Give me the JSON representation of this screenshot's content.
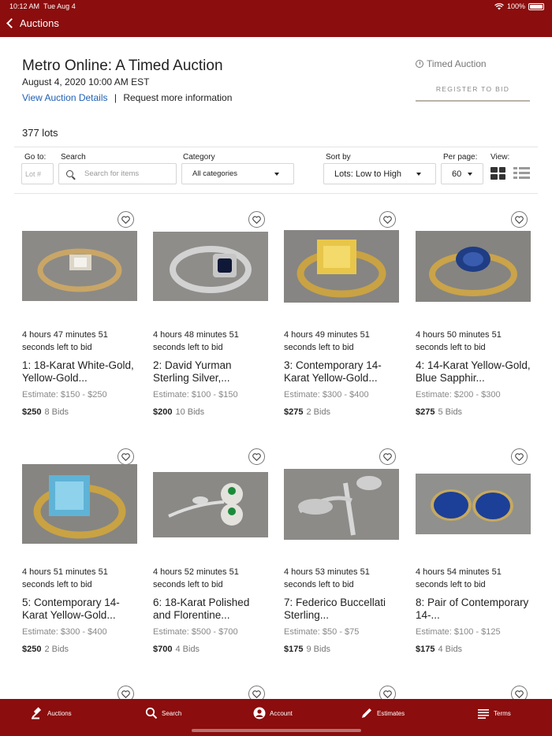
{
  "status": {
    "time": "10:12 AM",
    "date": "Tue Aug 4",
    "battery": "100%"
  },
  "nav": {
    "back_label": "Auctions"
  },
  "auction": {
    "title": "Metro Online: A Timed Auction",
    "date": "August 4, 2020 10:00 AM EST",
    "details_link": "View Auction Details",
    "separator": "|",
    "request_info": "Request more information",
    "type": "Timed Auction",
    "register_label": "REGISTER TO BID",
    "lot_count": "377 lots"
  },
  "filters": {
    "goto_label": "Go to:",
    "goto_placeholder": "Lot #",
    "search_label": "Search",
    "search_placeholder": "Search for items",
    "category_label": "Category",
    "category_value": "All categories",
    "sort_label": "Sort by",
    "sort_value": "Lots: Low to High",
    "perpage_label": "Per page:",
    "perpage_value": "60",
    "view_label": "View:"
  },
  "lots": [
    {
      "time_left": "4 hours 47 minutes 51 seconds left to bid",
      "name": "1: 18-Karat White-Gold, Yellow-Gold...",
      "estimate": "Estimate: $150 - $250",
      "price": "$250",
      "bids": "8 Bids",
      "image": "ring-white-gold"
    },
    {
      "time_left": "4 hours 48 minutes 51 seconds left to bid",
      "name": "2: David Yurman Sterling Silver,...",
      "estimate": "Estimate: $100 - $150",
      "price": "$200",
      "bids": "10 Bids",
      "image": "ring-yurman"
    },
    {
      "time_left": "4 hours 49 minutes 51 seconds left to bid",
      "name": "3: Contemporary 14-Karat Yellow-Gold...",
      "estimate": "Estimate: $300 - $400",
      "price": "$275",
      "bids": "2 Bids",
      "image": "ring-citrine"
    },
    {
      "time_left": "4 hours 50 minutes 51 seconds left to bid",
      "name": "4: 14-Karat Yellow-Gold, Blue Sapphir...",
      "estimate": "Estimate: $200 - $300",
      "price": "$275",
      "bids": "5 Bids",
      "image": "ring-sapphire"
    },
    {
      "time_left": "4 hours 51 minutes 51 seconds left to bid",
      "name": "5: Contemporary 14-Karat Yellow-Gold...",
      "estimate": "Estimate: $300 - $400",
      "price": "$250",
      "bids": "2 Bids",
      "image": "ring-blue-topaz"
    },
    {
      "time_left": "4 hours 52 minutes 51 seconds left to bid",
      "name": "6: 18-Karat Polished and Florentine...",
      "estimate": "Estimate: $500 - $700",
      "price": "$700",
      "bids": "4 Bids",
      "image": "brooch-flower"
    },
    {
      "time_left": "4 hours 53 minutes 51 seconds left to bid",
      "name": "7: Federico Buccellati Sterling...",
      "estimate": "Estimate: $50 - $75",
      "price": "$175",
      "bids": "9 Bids",
      "image": "silver-branch"
    },
    {
      "time_left": "4 hours 54 minutes 51 seconds left to bid",
      "name": "8: Pair of Contemporary 14-...",
      "estimate": "Estimate: $100 - $125",
      "price": "$175",
      "bids": "4 Bids",
      "image": "earrings-lapis"
    }
  ],
  "tabs": [
    {
      "label": "Auctions",
      "icon": "gavel-icon"
    },
    {
      "label": "Search",
      "icon": "search-icon"
    },
    {
      "label": "Account",
      "icon": "account-icon"
    },
    {
      "label": "Estimates",
      "icon": "pencil-icon"
    },
    {
      "label": "Terms",
      "icon": "terms-icon"
    }
  ],
  "colors": {
    "brand": "#8b0d0d",
    "link": "#1f5fb5"
  }
}
